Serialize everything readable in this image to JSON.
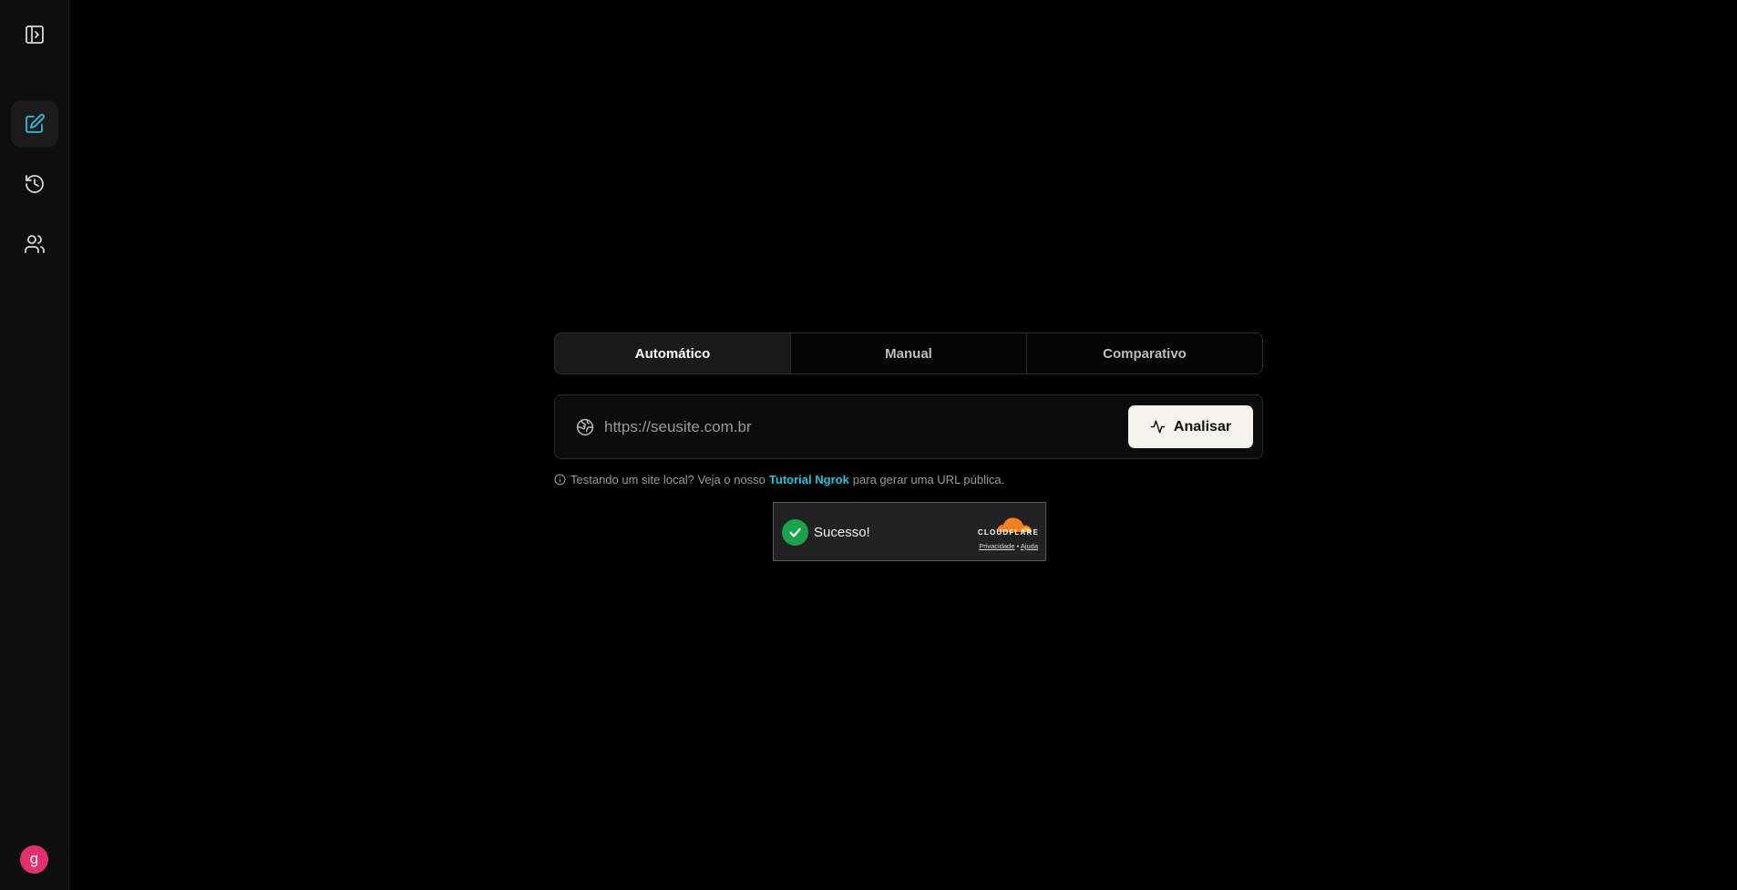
{
  "sidebar": {
    "items": [
      {
        "icon": "panel-toggle-icon"
      },
      {
        "icon": "edit-icon",
        "active": true
      },
      {
        "icon": "history-icon"
      },
      {
        "icon": "users-icon"
      }
    ],
    "avatar_letter": "g",
    "accent": "#22c4dd"
  },
  "tabs": {
    "items": [
      {
        "label": "Automático",
        "active": true
      },
      {
        "label": "Manual"
      },
      {
        "label": "Comparativo"
      }
    ]
  },
  "url_form": {
    "placeholder": "https://seusite.com.br",
    "value": "",
    "submit_label": "Analisar"
  },
  "hint": {
    "text_before": "Testando um site local? Veja o nosso",
    "link_text": "Tutorial Ngrok",
    "text_after": "para gerar uma URL pública."
  },
  "captcha": {
    "status": "Sucesso!",
    "brand": "CLOUDFLARE",
    "privacy_label": "Privacidade",
    "separator": "•",
    "help_label": "Ajuda"
  }
}
